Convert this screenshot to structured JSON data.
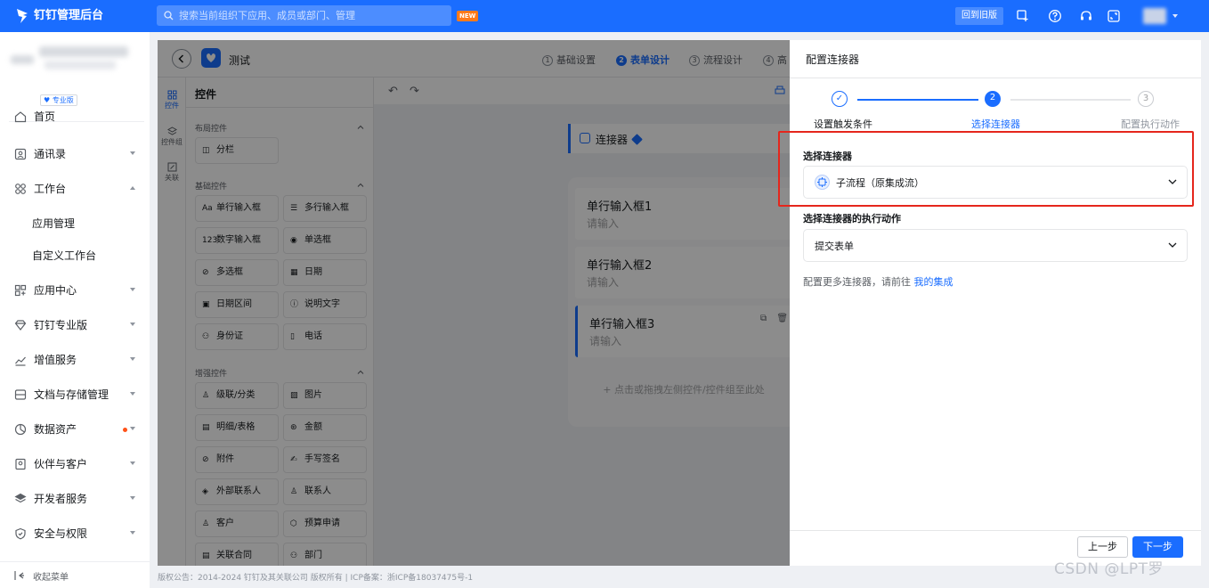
{
  "topbar": {
    "title": "钉钉管理后台",
    "search_placeholder": "搜索当前组织下应用、成员或部门、管理",
    "new_badge": "NEW",
    "old_version": "回到旧版",
    "icons": [
      "add-app-icon",
      "help-icon",
      "headset-icon",
      "fullscreen-icon"
    ]
  },
  "sidebar": {
    "org_badge": "专业版",
    "items": [
      {
        "label": "首页",
        "icon": "home-icon"
      },
      {
        "label": "通讯录",
        "icon": "contacts-icon"
      },
      {
        "label": "工作台",
        "icon": "workbench-icon"
      },
      {
        "label": "应用管理"
      },
      {
        "label": "自定义工作台"
      },
      {
        "label": "应用中心",
        "icon": "app-center-icon"
      },
      {
        "label": "钉钉专业版",
        "icon": "diamond-icon"
      },
      {
        "label": "增值服务",
        "icon": "chart-icon"
      },
      {
        "label": "文档与存储管理",
        "icon": "storage-icon"
      },
      {
        "label": "数据资产",
        "icon": "data-icon"
      },
      {
        "label": "伙伴与客户",
        "icon": "partner-icon"
      },
      {
        "label": "开发者服务",
        "icon": "layers-icon"
      },
      {
        "label": "安全与权限",
        "icon": "shield-icon"
      }
    ],
    "collapse": "收起菜单"
  },
  "form_header": {
    "title": "测试",
    "steps": [
      {
        "num": "1",
        "label": "基础设置"
      },
      {
        "num": "2",
        "label": "表单设计"
      },
      {
        "num": "3",
        "label": "流程设计"
      },
      {
        "num": "4",
        "label": "高"
      }
    ]
  },
  "left_tabs": [
    {
      "label": "控件"
    },
    {
      "label": "控件组"
    },
    {
      "label": "关联"
    }
  ],
  "widgets": {
    "title": "控件",
    "groups": [
      {
        "label": "布局控件"
      },
      {
        "label": "基础控件"
      },
      {
        "label": "增强控件"
      }
    ],
    "items": [
      {
        "label": "分栏",
        "icon": "◫"
      },
      {
        "label": "单行输入框",
        "icon": "Aa"
      },
      {
        "label": "多行输入框",
        "icon": "☰"
      },
      {
        "label": "数字输入框",
        "icon": "123"
      },
      {
        "label": "单选框",
        "icon": "◉"
      },
      {
        "label": "多选框",
        "icon": "⊘"
      },
      {
        "label": "日期",
        "icon": "▦"
      },
      {
        "label": "日期区间",
        "icon": "▣"
      },
      {
        "label": "说明文字",
        "icon": "ⓘ"
      },
      {
        "label": "身份证",
        "icon": "⚇"
      },
      {
        "label": "电话",
        "icon": "▯"
      },
      {
        "label": "级联/分类",
        "icon": "♙"
      },
      {
        "label": "图片",
        "icon": "▨"
      },
      {
        "label": "明细/表格",
        "icon": "▤"
      },
      {
        "label": "金额",
        "icon": "⊛"
      },
      {
        "label": "附件",
        "icon": "⊘"
      },
      {
        "label": "手写签名",
        "icon": "✍"
      },
      {
        "label": "外部联系人",
        "icon": "◈"
      },
      {
        "label": "联系人",
        "icon": "♙"
      },
      {
        "label": "客户",
        "icon": "♙"
      },
      {
        "label": "预算申请",
        "icon": "⬡"
      },
      {
        "label": "关联合同",
        "icon": "▤"
      },
      {
        "label": "部门",
        "icon": "⚇"
      }
    ]
  },
  "canvas": {
    "connector": "连接器",
    "fields": [
      {
        "label": "单行输入框1",
        "placeholder": "请输入"
      },
      {
        "label": "单行输入框2",
        "placeholder": "请输入"
      },
      {
        "label": "单行输入框3",
        "placeholder": "请输入"
      }
    ],
    "drop_hint": "+ 点击或拖拽左侧控件/控件组至此处"
  },
  "footer": "版权公告：2014-2024 钉钉及其关联公司 版权所有 | ICP备案：浙ICP备18037475号-1",
  "drawer": {
    "title": "配置连接器",
    "wizard": [
      {
        "label": "设置触发条件",
        "state": "done",
        "num": "✓"
      },
      {
        "label": "选择连接器",
        "state": "active",
        "num": "2"
      },
      {
        "label": "配置执行动作",
        "state": "pending",
        "num": "3"
      }
    ],
    "select_connector_label": "选择连接器",
    "select_connector_value": "子流程（原集成流）",
    "action_label": "选择连接器的执行动作",
    "action_value": "提交表单",
    "more_text": "配置更多连接器，请前往",
    "more_link": "我的集成",
    "prev": "上一步",
    "next": "下一步"
  },
  "watermark": "CSDN @LPT罗",
  "colors": {
    "accent": "#1a6dff",
    "highlight": "#e5261c"
  }
}
